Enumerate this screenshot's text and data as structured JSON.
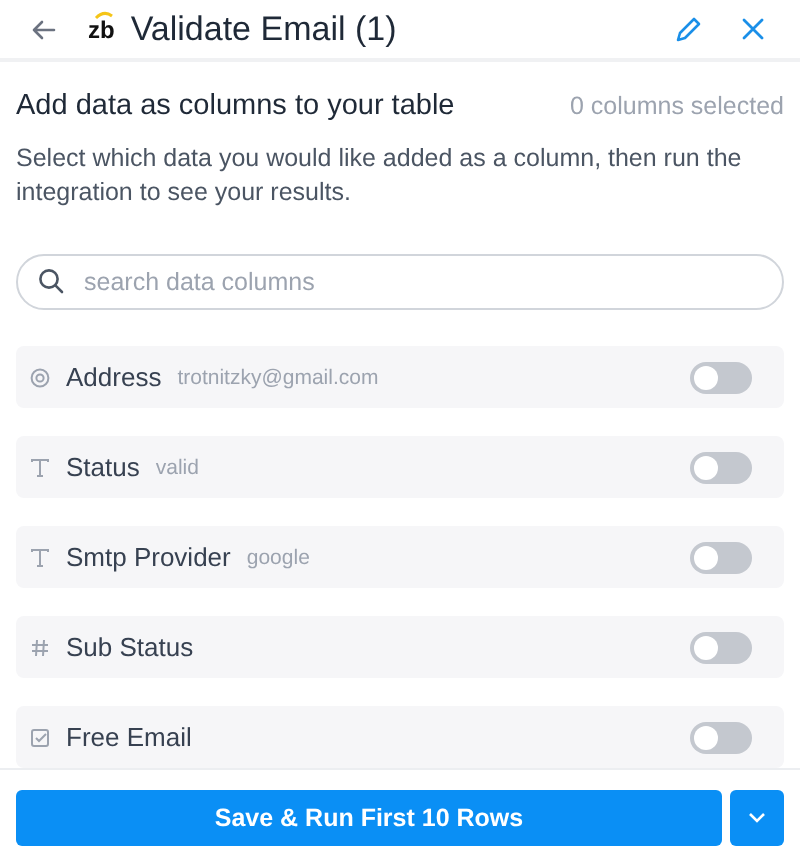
{
  "header": {
    "logo_text": "zb",
    "title": "Validate Email (1)"
  },
  "section": {
    "title": "Add data as columns to your table",
    "count": "0 columns selected",
    "description": "Select which data you would like added as a column, then run the integration to see your results."
  },
  "search": {
    "placeholder": "search data columns"
  },
  "columns": [
    {
      "kind": "email",
      "name": "Address",
      "sample": "trotnitzky@gmail.com",
      "on": false
    },
    {
      "kind": "text",
      "name": "Status",
      "sample": "valid",
      "on": false
    },
    {
      "kind": "text",
      "name": "Smtp Provider",
      "sample": "google",
      "on": false
    },
    {
      "kind": "number",
      "name": "Sub Status",
      "on": false
    },
    {
      "kind": "checkbox",
      "name": "Free Email",
      "on": false
    }
  ],
  "footer": {
    "button": "Save & Run First 10 Rows"
  }
}
